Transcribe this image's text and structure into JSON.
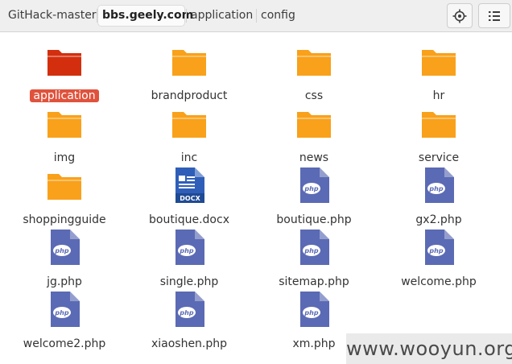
{
  "breadcrumb": {
    "items": [
      {
        "label": "GitHack-master"
      },
      {
        "label": "bbs.geely.com"
      },
      {
        "label": "application"
      },
      {
        "label": "config"
      }
    ],
    "active_index": 1
  },
  "toolbar": {
    "location_button_icon": "crosshair-icon",
    "view_button_icon": "list-view-icon"
  },
  "files": [
    {
      "name": "application",
      "type": "folder",
      "selected": true
    },
    {
      "name": "brandproduct",
      "type": "folder"
    },
    {
      "name": "css",
      "type": "folder"
    },
    {
      "name": "hr",
      "type": "folder"
    },
    {
      "name": "img",
      "type": "folder"
    },
    {
      "name": "inc",
      "type": "folder"
    },
    {
      "name": "news",
      "type": "folder"
    },
    {
      "name": "service",
      "type": "folder"
    },
    {
      "name": "shoppingguide",
      "type": "folder"
    },
    {
      "name": "boutique.docx",
      "type": "docx"
    },
    {
      "name": "boutique.php",
      "type": "php"
    },
    {
      "name": "gx2.php",
      "type": "php"
    },
    {
      "name": "jg.php",
      "type": "php"
    },
    {
      "name": "single.php",
      "type": "php"
    },
    {
      "name": "sitemap.php",
      "type": "php"
    },
    {
      "name": "welcome.php",
      "type": "php"
    },
    {
      "name": "welcome2.php",
      "type": "php"
    },
    {
      "name": "xiaoshen.php",
      "type": "php"
    },
    {
      "name": "xm.php",
      "type": "php"
    }
  ],
  "icon_text": {
    "php": "php",
    "docx": "DOCX"
  },
  "colors": {
    "folder": "#f9a11b",
    "folder_selected": "#d32f0e",
    "php_icon": "#5b6ab4",
    "docx_icon": "#2e5eb8",
    "selection": "#e0523c"
  },
  "watermark": {
    "text": "www.wooyun.org"
  }
}
